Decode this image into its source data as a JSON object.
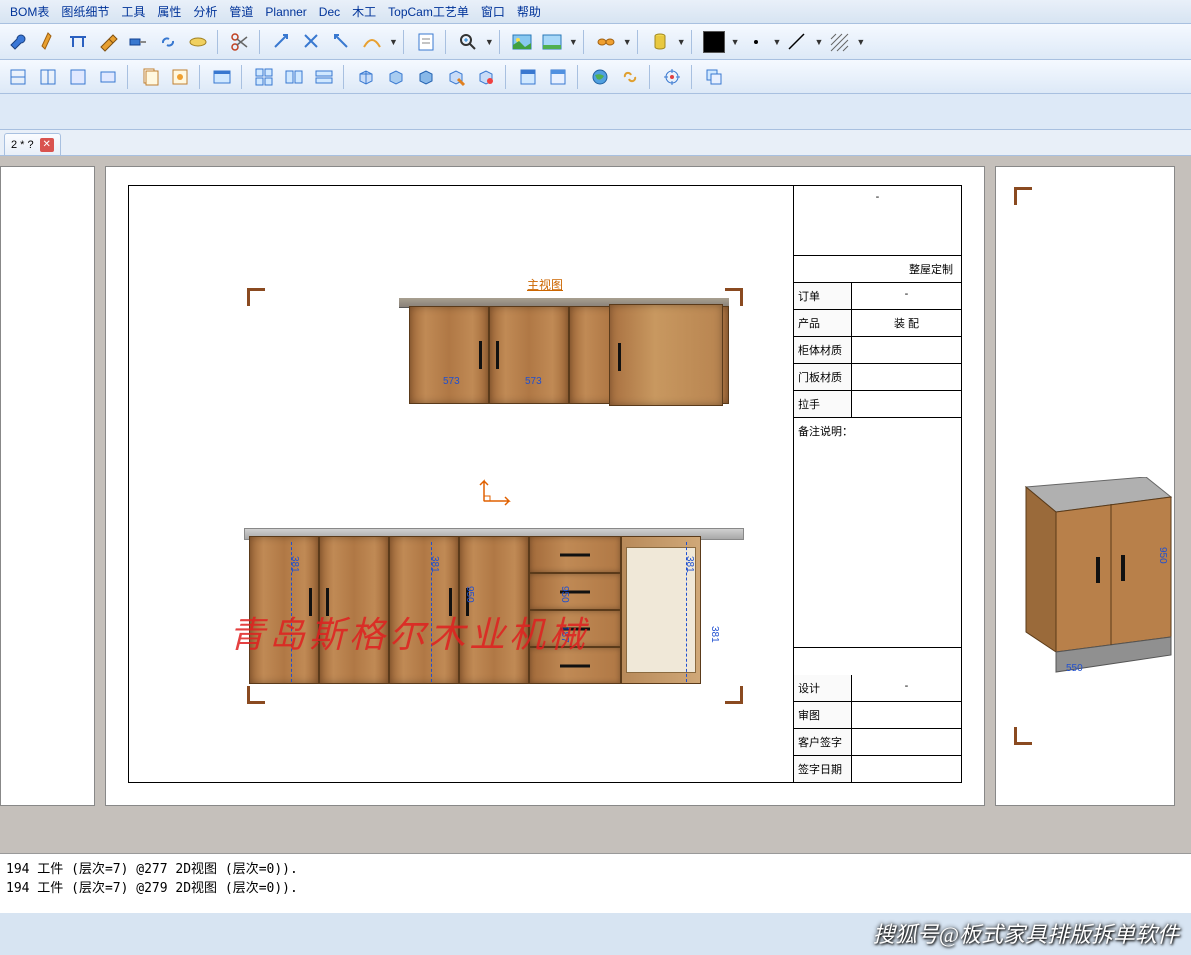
{
  "menu": {
    "bom": "BOM表",
    "drawing_detail": "图纸细节",
    "tools": "工具",
    "properties": "属性",
    "analysis": "分析",
    "pipe": "管道",
    "planner": "Planner",
    "dec": "Dec",
    "woodwork": "木工",
    "topcam": "TopCam工艺单",
    "window": "窗口",
    "help": "帮助"
  },
  "tab": {
    "label": "2 * ?"
  },
  "drawing": {
    "view_label": "主视图",
    "dims": {
      "d573a": "573",
      "d573b": "573",
      "d381a": "381",
      "d381b": "381",
      "d381c": "381",
      "d381d": "381",
      "d950a": "950",
      "d950b": "950",
      "d187": "187",
      "d550": "550",
      "d950c": "950"
    }
  },
  "titleblock": {
    "header_dash": "-",
    "header_custom": "整屋定制",
    "order_label": "订单",
    "order_val": "-",
    "product_label": "产品",
    "product_val": "装 配",
    "cabinet_mat_label": "柜体材质",
    "cabinet_mat_val": "",
    "door_mat_label": "门板材质",
    "door_mat_val": "",
    "handle_label": "拉手",
    "handle_val": "",
    "notes_label": "备注说明：",
    "design_label": "设计",
    "design_val": "-",
    "review_label": "审图",
    "review_val": "",
    "cust_sign_label": "客户签字",
    "cust_sign_val": "",
    "sign_date_label": "签字日期",
    "sign_date_val": ""
  },
  "watermark": "青岛斯格尔木业机械",
  "status": {
    "line1": "194 工件 (层次=7) @277 2D视图 (层次=0)).",
    "line2": "194 工件 (层次=7) @279 2D视图 (层次=0))."
  },
  "footer": "搜狐号@板式家具排版拆单软件"
}
